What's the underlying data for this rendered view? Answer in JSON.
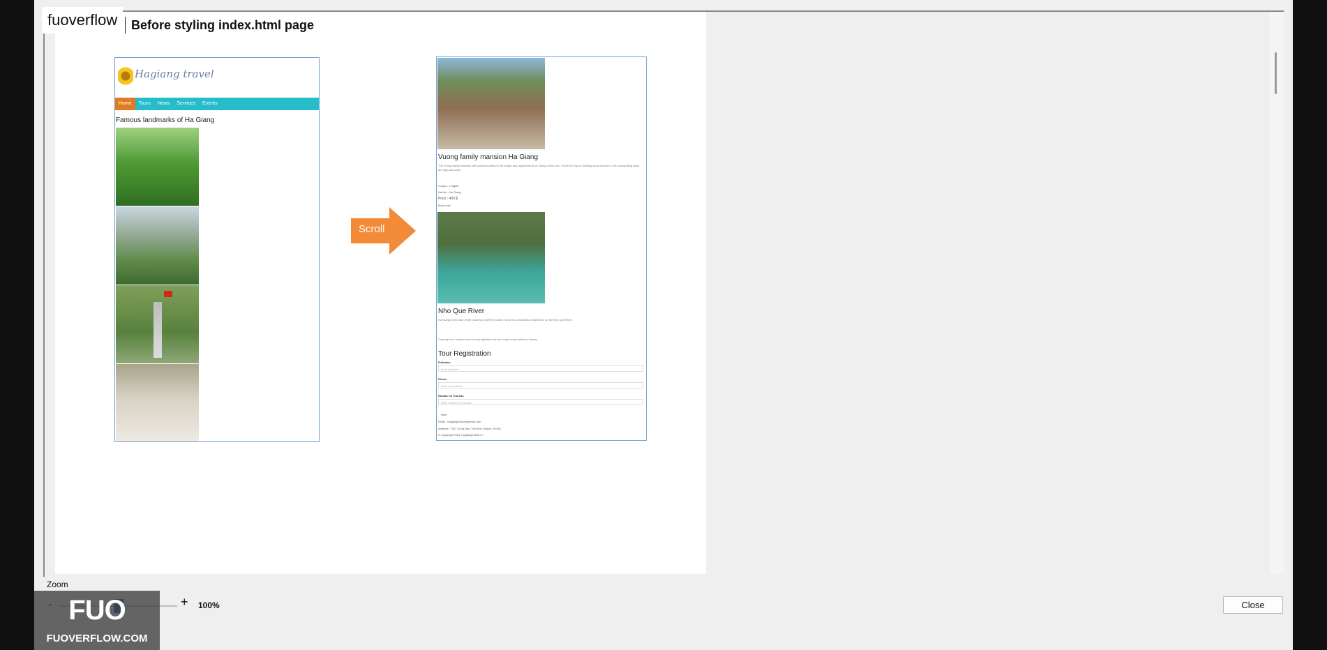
{
  "brand": "fuoverflow",
  "slide_title": "Before styling index.html page",
  "left_mock": {
    "logo_text": "Hagiang travel",
    "nav": [
      "Home",
      "Tours",
      "News",
      "Services",
      "Events"
    ],
    "heading": "Famous landmarks of Ha Giang"
  },
  "arrow_label": "Scroll",
  "right_mock": {
    "heading1": "Vuong family mansion Ha Giang",
    "para1": "The Vuong family mansion was built according to the shape and requirements of Vuong Chinh Duc. From the way of building stone structure, the surrounding walls are high and solid.",
    "info1": "3 days - 2 nights",
    "info2": "Ha Noi - Ha Giang",
    "price": "Price : 400 $",
    "book": "Book now",
    "heading2": "Nho Que River",
    "para2": "Ha Giang is the land of the country's northern border, home to a wonderful experience on the Nho Que River.",
    "para3": "Coming here, visitors can not only sightsee but also enjoy many delicious dishes.",
    "form_title": "Tour Registration",
    "label_fullname": "Fullname",
    "placeholder_fullname": "Enter fullname",
    "label_phone": "Phone",
    "placeholder_phone": "Enter your phone",
    "label_tourists": "Number of Tourists",
    "placeholder_tourists": "Enter number of Tourists",
    "submit": "Next",
    "email": "Email : HagiangTravel@gmail.com",
    "address": "Address : TDC Cong Hoa, Tan Binh District, HCMC",
    "copyright": "© Copyright 2024. HagiangTravel.vn"
  },
  "zoom": {
    "label": "Zoom",
    "minus": "-",
    "plus": "+",
    "value": "100%"
  },
  "close_label": "Close",
  "watermark": {
    "logo": "FUO",
    "url": "FUOVERFLOW.COM"
  }
}
